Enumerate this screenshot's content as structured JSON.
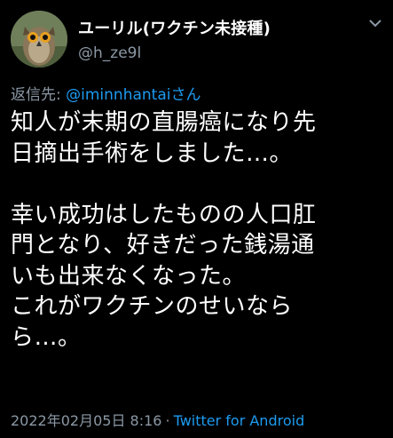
{
  "author": {
    "display_name": "ユーリル(ワクチン未接種)",
    "handle": "@h_ze9l",
    "avatar_icon": "owl-avatar-icon"
  },
  "more_icon": "chevron-down-icon",
  "reply": {
    "label": "返信先: ",
    "user": "@iminnhantai",
    "suffix": "さん"
  },
  "body": {
    "lines": [
      "知人が末期の直腸癌になり先",
      "日摘出手術をしました…。",
      "",
      "幸い成功はしたものの人口肛",
      "門となり、好きだった銭湯通",
      "いも出来なくなった。",
      "これがワクチンのせいなら",
      "ら…。"
    ]
  },
  "meta": {
    "date": "2022年02月05日 8:16",
    "separator": "·",
    "source": "Twitter for Android"
  },
  "colors": {
    "background": "#000000",
    "link": "#1d9bf0",
    "secondary_text": "#8b98a5",
    "primary_text": "#ffffff"
  }
}
